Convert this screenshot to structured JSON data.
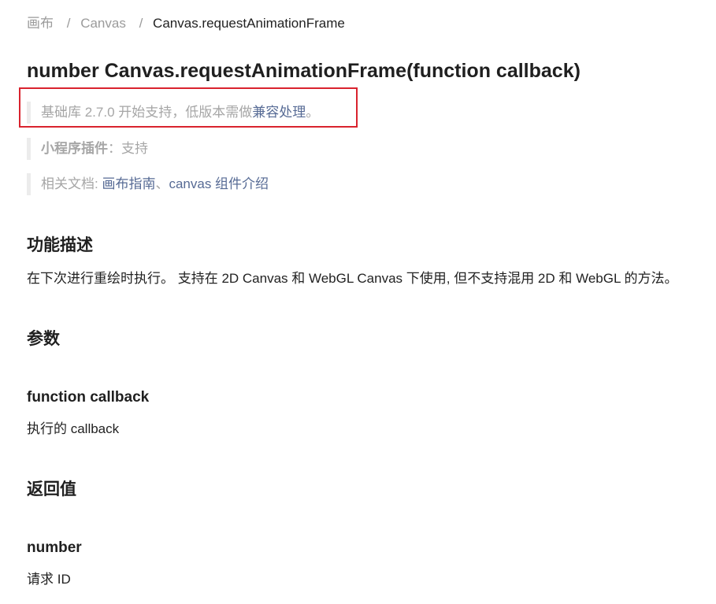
{
  "breadcrumb": {
    "items": [
      "画布",
      "Canvas",
      "Canvas.requestAnimationFrame"
    ],
    "separator": "/"
  },
  "title": "number Canvas.requestAnimationFrame(function callback)",
  "notes": {
    "base_library": {
      "text": "基础库 2.7.0 开始支持，低版本需做",
      "link": "兼容处理",
      "suffix": "。"
    },
    "plugin": {
      "label": "小程序插件",
      "colon": "：",
      "value": "支持"
    },
    "docs": {
      "label": "相关文档: ",
      "link1": "画布指南",
      "separator": "、",
      "link2": "canvas 组件介绍"
    }
  },
  "sections": {
    "description": {
      "heading": "功能描述",
      "text": "在下次进行重绘时执行。 支持在 2D Canvas 和 WebGL Canvas 下使用, 但不支持混用 2D 和 WebGL 的方法。"
    },
    "params": {
      "heading": "参数",
      "param_name": "function callback",
      "param_desc": "执行的 callback"
    },
    "return": {
      "heading": "返回值",
      "type": "number",
      "desc": "请求 ID"
    }
  },
  "colors": {
    "link": "#576b95",
    "highlight_border": "#d9232e",
    "muted_text": "#a6a6a6"
  }
}
